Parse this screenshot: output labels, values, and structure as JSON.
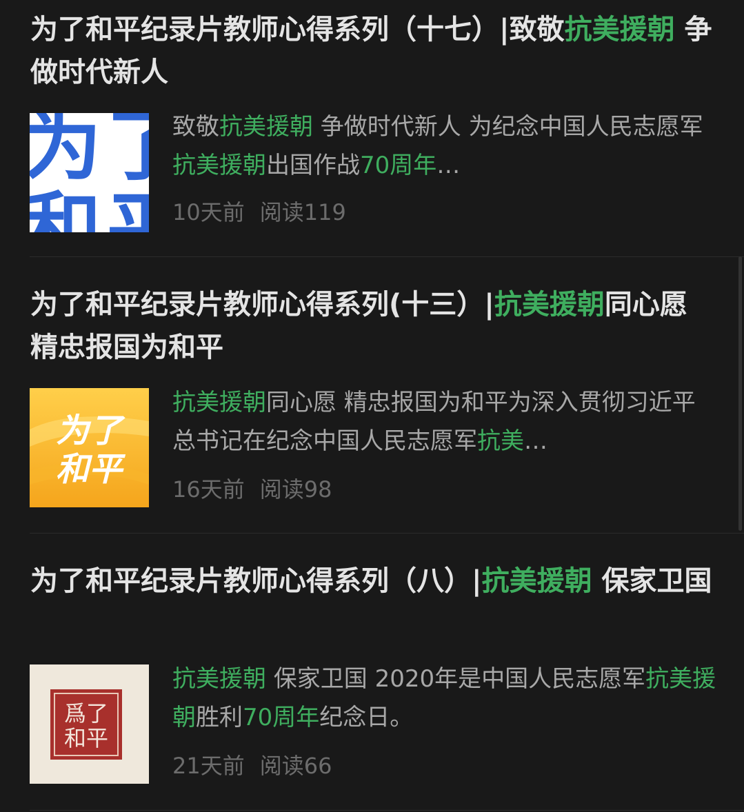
{
  "colors": {
    "background": "#191919",
    "title_text": "#e4e4e4",
    "summary_text": "#a8a8a8",
    "meta_text": "#6c6c6c",
    "highlight": "#3fae5f"
  },
  "articles": [
    {
      "title": {
        "a": "为了和平纪录片教师心得系列（十七）|致敬",
        "b": "抗美援朝",
        "c": " 争做时代新人"
      },
      "summary": {
        "a": "致敬",
        "b": "抗美援朝",
        "c": " 争做时代新人 为纪念中国人民志愿军",
        "d": "抗美援朝",
        "e": "出国作战",
        "f": "70周年",
        "g": "…"
      },
      "thumbnail": {
        "icon": "poster-thumbnail-icon",
        "chars": [
          "为",
          "了",
          "和",
          "平"
        ]
      },
      "date": "10天前",
      "reads": "阅读119"
    },
    {
      "title": {
        "a": "为了和平纪录片教师心得系列(十三）|",
        "b": "抗美援朝",
        "c": "同心愿 精忠报国为和平"
      },
      "summary": {
        "a": "",
        "b": "抗美援朝",
        "c": "同心愿 精忠报国为和平为深入贯彻习近平总书记在纪念中国人民志愿军",
        "d": "抗美",
        "e": "…",
        "f": "",
        "g": ""
      },
      "thumbnail": {
        "icon": "poster-thumbnail-icon",
        "line1": "为了",
        "line2": "和平"
      },
      "date": "16天前",
      "reads": "阅读98"
    },
    {
      "title": {
        "a": "为了和平纪录片教师心得系列（八）|",
        "b": "抗美援朝",
        "c": " 保家卫国"
      },
      "summary": {
        "a": "",
        "b": "抗美援朝",
        "c": " 保家卫国 2020年是中国人民志愿军",
        "d": "抗美援朝",
        "e": "胜利",
        "f": "70周年",
        "g": "纪念日。"
      },
      "thumbnail": {
        "icon": "seal-thumbnail-icon",
        "line1": "爲了",
        "line2": "和平"
      },
      "date": "21天前",
      "reads": "阅读66"
    }
  ]
}
